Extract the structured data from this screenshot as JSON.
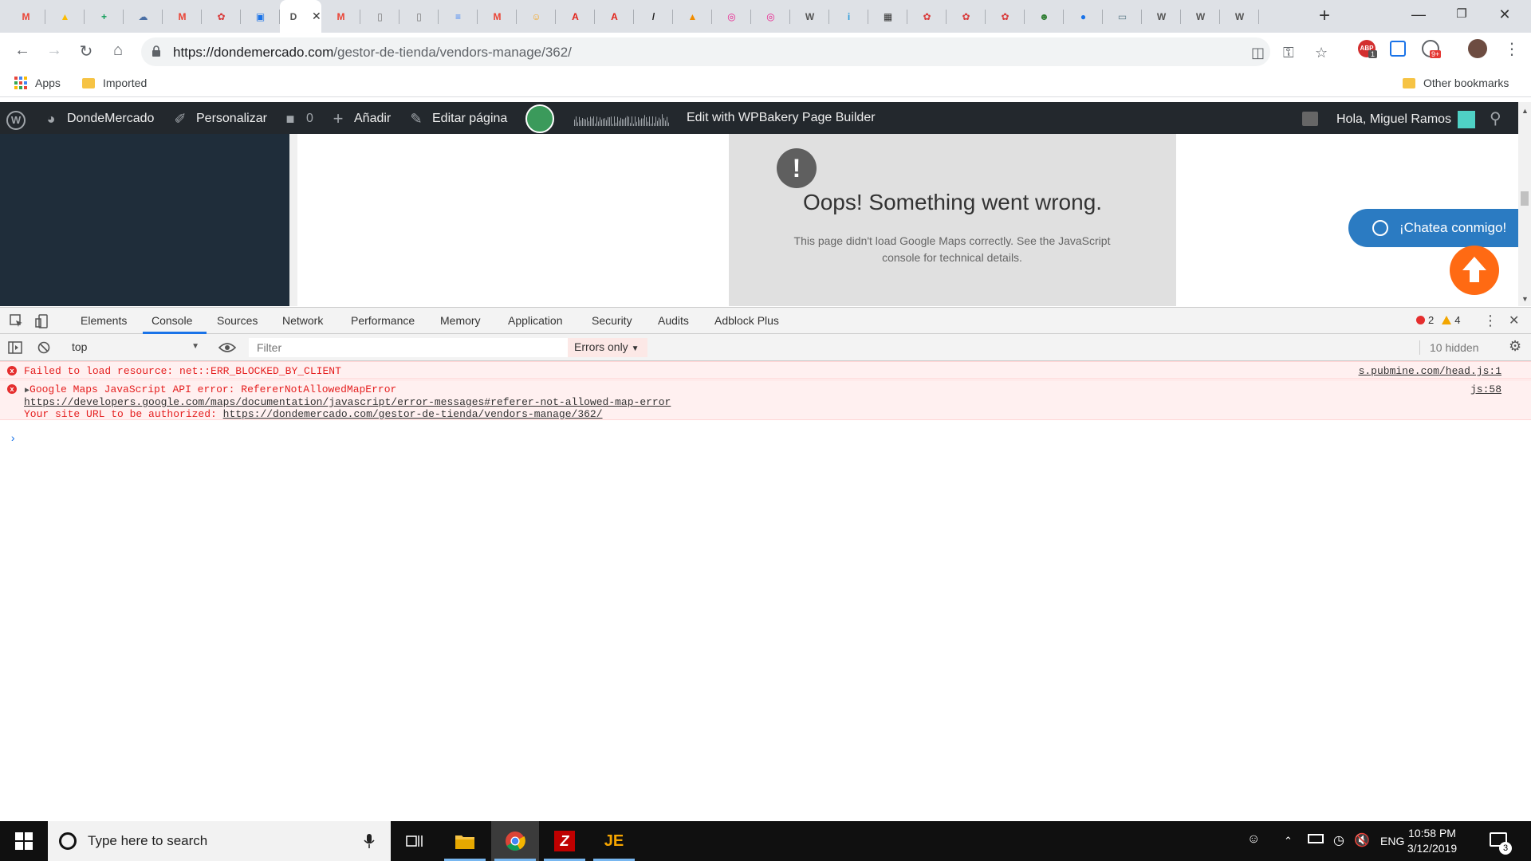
{
  "browser": {
    "tabs": [
      {
        "icon": "gmail-icon",
        "glyph": "M",
        "color": "#ea4335"
      },
      {
        "icon": "drive-icon",
        "glyph": "▲",
        "color": "#fbbc04"
      },
      {
        "icon": "sheets-icon",
        "glyph": "+",
        "color": "#0f9d58"
      },
      {
        "icon": "cloud-icon",
        "glyph": "☁",
        "color": "#4a6fa5"
      },
      {
        "icon": "gmail-icon",
        "glyph": "M",
        "color": "#ea4335"
      },
      {
        "icon": "dondemercado-icon",
        "glyph": "✿",
        "color": "#d93a3a"
      },
      {
        "icon": "bag-icon",
        "glyph": "▣",
        "color": "#1a73e8"
      },
      {
        "icon": "dondemercado-icon",
        "glyph": "✿",
        "color": "#d93a3a"
      },
      {
        "icon": "gmail-icon",
        "glyph": "M",
        "color": "#ea4335"
      },
      {
        "icon": "document-icon",
        "glyph": "▯",
        "color": "#777777"
      },
      {
        "icon": "document-icon",
        "glyph": "▯",
        "color": "#777777"
      },
      {
        "icon": "docs-icon",
        "glyph": "≡",
        "color": "#4285f4"
      },
      {
        "icon": "gmail-icon",
        "glyph": "M",
        "color": "#ea4335"
      },
      {
        "icon": "smiley-icon",
        "glyph": "☺",
        "color": "#f5a623"
      },
      {
        "icon": "acrobat-icon",
        "glyph": "A",
        "color": "#e2231a"
      },
      {
        "icon": "acrobat-icon",
        "glyph": "A",
        "color": "#e2231a"
      },
      {
        "icon": "slash-icon",
        "glyph": "/",
        "color": "#222222"
      },
      {
        "icon": "pma-icon",
        "glyph": "▲",
        "color": "#f08c00"
      },
      {
        "icon": "gitlab-icon",
        "glyph": "◎",
        "color": "#e91e8c"
      },
      {
        "icon": "gitlab-icon",
        "glyph": "◎",
        "color": "#e91e8c"
      },
      {
        "icon": "wordpress-icon",
        "glyph": "W",
        "color": "#555555"
      },
      {
        "icon": "ibb-icon",
        "glyph": "i",
        "color": "#2d9cdb"
      },
      {
        "icon": "film-icon",
        "glyph": "▦",
        "color": "#333333"
      },
      {
        "icon": "dondemercado-icon",
        "glyph": "✿",
        "color": "#d93a3a"
      },
      {
        "icon": "dondemercado-icon",
        "glyph": "✿",
        "color": "#d93a3a"
      },
      {
        "icon": "dondemercado-icon",
        "glyph": "✿",
        "color": "#d93a3a"
      },
      {
        "icon": "avatar-icon",
        "glyph": "☻",
        "color": "#2e7d32"
      },
      {
        "icon": "globe-icon",
        "glyph": "●",
        "color": "#1a73e8"
      },
      {
        "icon": "monitor-icon",
        "glyph": "▭",
        "color": "#607d8b"
      },
      {
        "icon": "wordpress-icon",
        "glyph": "W",
        "color": "#555555"
      },
      {
        "icon": "wordpress-icon",
        "glyph": "W",
        "color": "#555555"
      },
      {
        "icon": "wordpress-icon",
        "glyph": "W",
        "color": "#555555"
      }
    ],
    "active_tab_index": 7,
    "active_tab_title": "D",
    "close_glyph": "✕",
    "new_tab_glyph": "+",
    "url_host": "https://dondemercado.com",
    "url_path": "/gestor-de-tienda/vendors-manage/362/",
    "bookmarks": {
      "apps": "Apps",
      "imported": "Imported",
      "other": "Other bookmarks"
    },
    "extension_badges": {
      "abp": "1",
      "notifications": "9+"
    }
  },
  "wp_admin_bar": {
    "site_name": "DondeMercado",
    "customize": "Personalizar",
    "comments_count": "0",
    "add_new": "Añadir",
    "edit_page": "Editar página",
    "wpbakery": "Edit with WPBakery Page Builder",
    "greeting": "Hola, Miguel Ramos"
  },
  "page": {
    "map_error_title": "Oops! Something went wrong.",
    "map_error_desc": "This page didn't load Google Maps correctly. See the JavaScript console for technical details.",
    "chat_button": "¡Chatea conmigo!"
  },
  "devtools": {
    "tabs": [
      "Elements",
      "Console",
      "Sources",
      "Network",
      "Performance",
      "Memory",
      "Application",
      "Security",
      "Audits",
      "Adblock Plus"
    ],
    "active_tab": "Console",
    "error_count": "2",
    "warning_count": "4",
    "context": "top",
    "filter_placeholder": "Filter",
    "levels": "Errors only",
    "hidden": "10 hidden",
    "messages": [
      {
        "text": "Failed to load resource: net::ERR_BLOCKED_BY_CLIENT",
        "source": "s.pubmine.com/head.js:1"
      },
      {
        "text": "Google Maps JavaScript API error: RefererNotAllowedMapError",
        "link": "https://developers.google.com/maps/documentation/javascript/error-messages#referer-not-allowed-map-error",
        "line3_prefix": "Your site URL to be authorized: ",
        "line3_link": "https://dondemercado.com/gestor-de-tienda/vendors-manage/362/",
        "source": "js:58"
      }
    ]
  },
  "taskbar": {
    "search_placeholder": "Type here to search",
    "language": "ENG",
    "time": "10:58 PM",
    "date": "3/12/2019",
    "notification_count": "3"
  }
}
